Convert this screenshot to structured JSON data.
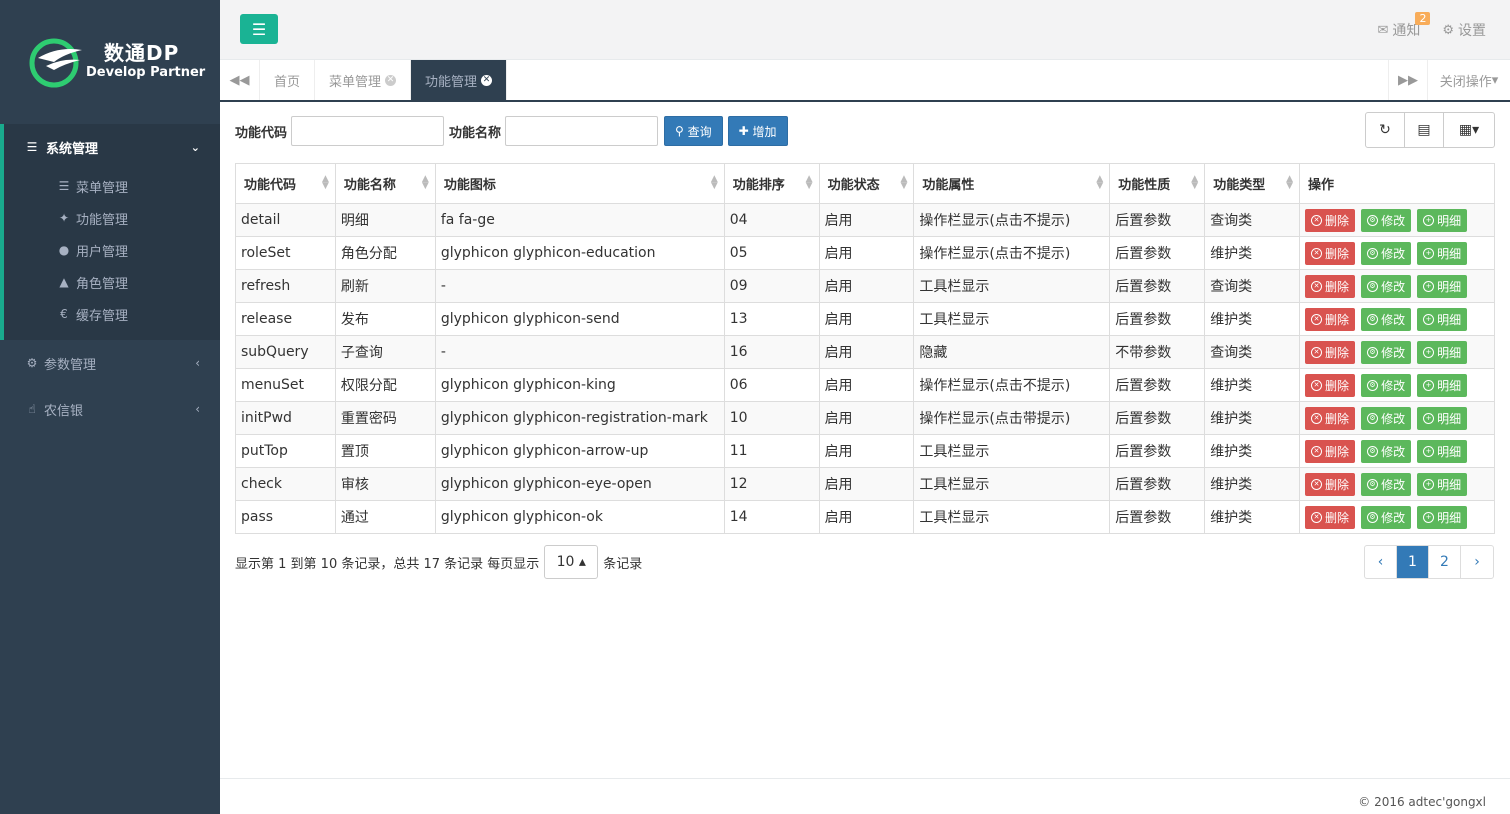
{
  "logo": {
    "title": "数通DP",
    "subtitle": "Develop Partner"
  },
  "sidebar": {
    "groups": [
      {
        "label": "系统管理",
        "items": [
          {
            "label": "菜单管理",
            "icon": "list-icon"
          },
          {
            "label": "功能管理",
            "icon": "cogs-icon"
          },
          {
            "label": "用户管理",
            "icon": "user-icon"
          },
          {
            "label": "角色管理",
            "icon": "graduation-cap-icon"
          },
          {
            "label": "缓存管理",
            "icon": "euro-icon"
          }
        ]
      }
    ],
    "params_label": "参数管理",
    "nongxin_label": "农信银"
  },
  "header": {
    "notify_label": "通知",
    "notify_count": "2",
    "settings_label": "设置"
  },
  "tabs": [
    {
      "label": "首页"
    },
    {
      "label": "菜单管理"
    },
    {
      "label": "功能管理"
    }
  ],
  "close_ops_label": "关闭操作",
  "search": {
    "code_label": "功能代码",
    "name_label": "功能名称",
    "code_value": "",
    "name_value": "",
    "query_label": "查询",
    "add_label": "增加"
  },
  "table": {
    "headers": [
      "功能代码",
      "功能名称",
      "功能图标",
      "功能排序",
      "功能状态",
      "功能属性",
      "功能性质",
      "功能类型",
      "操作"
    ],
    "actions": {
      "delete": "删除",
      "edit": "修改",
      "detail": "明细"
    },
    "rows": [
      [
        "detail",
        "明细",
        "fa fa-ge",
        "04",
        "启用",
        "操作栏显示(点击不提示)",
        "后置参数",
        "查询类"
      ],
      [
        "roleSet",
        "角色分配",
        "glyphicon glyphicon-education",
        "05",
        "启用",
        "操作栏显示(点击不提示)",
        "后置参数",
        "维护类"
      ],
      [
        "refresh",
        "刷新",
        "-",
        "09",
        "启用",
        "工具栏显示",
        "后置参数",
        "查询类"
      ],
      [
        "release",
        "发布",
        "glyphicon glyphicon-send",
        "13",
        "启用",
        "工具栏显示",
        "后置参数",
        "维护类"
      ],
      [
        "subQuery",
        "子查询",
        "-",
        "16",
        "启用",
        "隐藏",
        "不带参数",
        "查询类"
      ],
      [
        "menuSet",
        "权限分配",
        "glyphicon glyphicon-king",
        "06",
        "启用",
        "操作栏显示(点击不提示)",
        "后置参数",
        "维护类"
      ],
      [
        "initPwd",
        "重置密码",
        "glyphicon glyphicon-registration-mark",
        "10",
        "启用",
        "操作栏显示(点击带提示)",
        "后置参数",
        "维护类"
      ],
      [
        "putTop",
        "置顶",
        "glyphicon glyphicon-arrow-up",
        "11",
        "启用",
        "工具栏显示",
        "后置参数",
        "维护类"
      ],
      [
        "check",
        "审核",
        "glyphicon glyphicon-eye-open",
        "12",
        "启用",
        "工具栏显示",
        "后置参数",
        "维护类"
      ],
      [
        "pass",
        "通过",
        "glyphicon glyphicon-ok",
        "14",
        "启用",
        "工具栏显示",
        "后置参数",
        "维护类"
      ]
    ]
  },
  "pager": {
    "info": "显示第 1 到第 10 条记录，总共 17 条记录 每页显示",
    "page_size": "10",
    "suffix": "条记录",
    "prev": "‹",
    "pages": [
      "1",
      "2"
    ],
    "next": "›"
  },
  "footer": "© 2016 adtec'gongxl",
  "colors": {
    "sidebar": "#2f4050",
    "accent": "#1ab394",
    "primary": "#337ab7",
    "danger": "#d9534f",
    "success": "#5cb85c"
  }
}
